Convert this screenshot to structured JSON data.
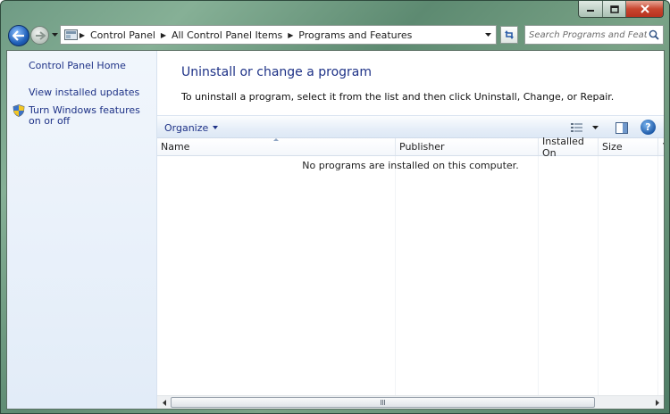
{
  "window": {
    "caption_buttons": {
      "minimize": "minimize-icon",
      "maximize": "maximize-icon",
      "close": "close-icon"
    }
  },
  "address_bar": {
    "crumbs": [
      "Control Panel",
      "All Control Panel Items",
      "Programs and Features"
    ]
  },
  "search": {
    "placeholder": "Search Programs and Featu..."
  },
  "left_pane": {
    "links": [
      "Control Panel Home",
      "View installed updates",
      "Turn Windows features on or off"
    ]
  },
  "main": {
    "heading": "Uninstall or change a program",
    "subtext": "To uninstall a program, select it from the list and then click Uninstall, Change, or Repair."
  },
  "toolbar": {
    "organize": "Organize",
    "help": "?"
  },
  "list": {
    "columns": [
      "Name",
      "Publisher",
      "Installed On",
      "Size",
      "V"
    ],
    "empty_message": "No programs are installed on this computer."
  },
  "colors": {
    "link": "#1e3287",
    "pane_bg": "#e9f0f9",
    "heading": "#1e3287"
  }
}
